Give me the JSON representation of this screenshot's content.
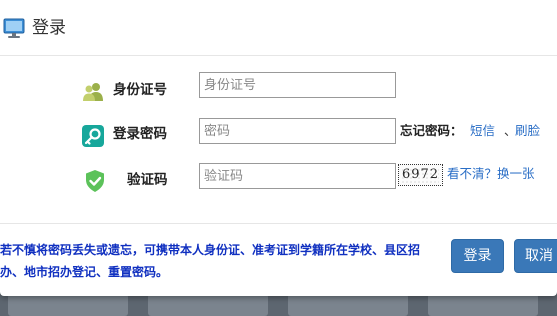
{
  "dialog": {
    "title": "登录",
    "title_icon": "monitor-icon"
  },
  "form": {
    "id_number": {
      "label": "身份证号",
      "placeholder": "身份证号",
      "icon": "users-icon"
    },
    "password": {
      "label": "登录密码",
      "placeholder": "密码",
      "icon": "key-icon"
    },
    "captcha": {
      "label": "验证码",
      "placeholder": "验证码",
      "icon": "shield-check-icon",
      "image_text": "6972"
    }
  },
  "forgot": {
    "label": "忘记密码：",
    "sms_link": "短信",
    "separator": "、",
    "face_link": "刷脸"
  },
  "captcha_refresh": "看不清？换一张",
  "notice": "若不慎将密码丢失或遗忘，可携带本人身份证、准考证到学籍所在学校、县区招办、地市招办登记、重置密码。",
  "buttons": {
    "login": "登录",
    "cancel": "取消"
  },
  "colors": {
    "primary_button": "#3a78b8",
    "link": "#2a6ec6",
    "notice_text": "#1030c0"
  }
}
